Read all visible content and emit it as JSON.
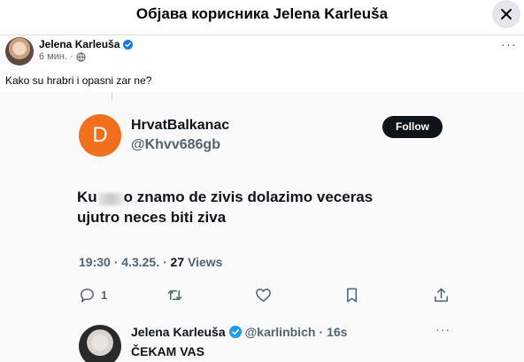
{
  "dialog": {
    "title": "Објава корисника Jelena Karleuša"
  },
  "post": {
    "author": "Jelena Karleuša",
    "time": "6 мин.",
    "separator": "·",
    "text": "Kako su hrabri i opasni zar ne?",
    "menu": "···"
  },
  "tweet": {
    "avatar_letter": "D",
    "avatar_color": "#f2701c",
    "name": "HrvatBalkanac",
    "handle": "@Khvv686gb",
    "follow_label": "Follow",
    "text_prefix": "Ku",
    "text_blur_suffix": "o znamo de zivis dolazimo veceras",
    "text_line2": "ujutro neces biti ziva",
    "time": "19:30",
    "dot1": "·",
    "date": "4.3.25.",
    "dot2": "·",
    "views_count": "27",
    "views_label": "Views",
    "reply_count": "1"
  },
  "reply": {
    "name": "Jelena Karleuša",
    "handle": "@karlinbich",
    "dot": "·",
    "time": "16s",
    "menu": "···",
    "text": "ČEKAM VAS"
  },
  "icons": {
    "close": "close-icon",
    "verified": "verified-badge-icon",
    "globe": "globe-icon",
    "reply": "reply-icon",
    "retweet": "retweet-icon",
    "like": "heart-icon",
    "bookmark": "bookmark-icon",
    "share": "share-icon"
  },
  "colors": {
    "verified_blue": "#1877f2",
    "twitter_text": "#0f1419",
    "twitter_secondary": "#536471"
  }
}
